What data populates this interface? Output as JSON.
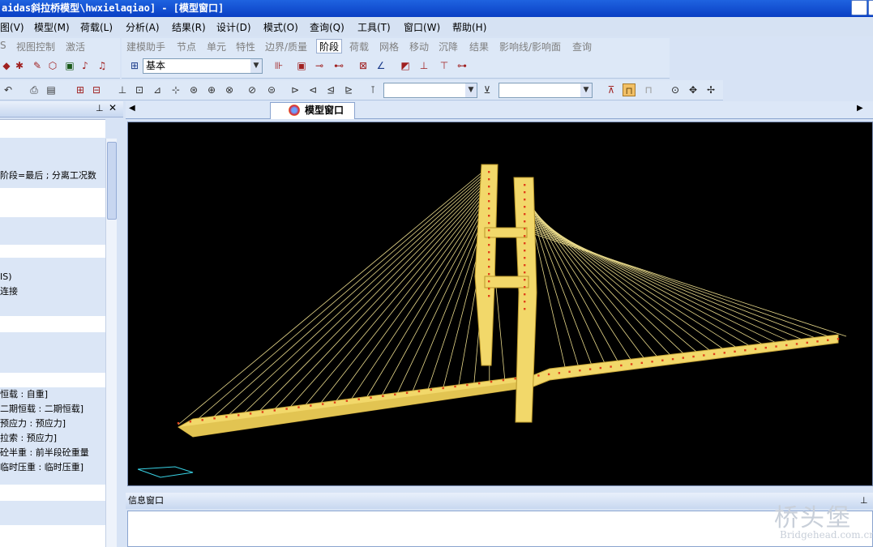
{
  "window": {
    "title": "aidas斜拉桥模型\\hwxielaqiao] - [模型窗口]"
  },
  "menu": [
    "图(V)",
    "模型(M)",
    "荷载(L)",
    "分析(A)",
    "结果(R)",
    "设计(D)",
    "模式(O)",
    "查询(Q)",
    "工具(T)",
    "窗口(W)",
    "帮助(H)"
  ],
  "toolbar1": {
    "left_tabs": [
      "S",
      "视图控制",
      "激活"
    ],
    "tabs": [
      "建模助手",
      "节点",
      "单元",
      "特性",
      "边界/质量",
      "阶段",
      "荷载",
      "网格",
      "移动",
      "沉降",
      "结果",
      "影响线/影响面",
      "查询"
    ],
    "active_tab": "阶段",
    "stage_select": "基本"
  },
  "panel": {
    "tree_rows": [
      "阶段=最后 ; 分离工况数",
      "IS)",
      "连接",
      "恒载 : 自重]",
      "二期恒载 : 二期恒载]",
      "预应力 : 预应力]",
      "拉索 : 预应力]",
      "砼半重 : 前半段砼重量",
      "临时压重 : 临时压重]"
    ]
  },
  "model_tab": {
    "label": "模型窗口"
  },
  "info": {
    "title": "信息窗口"
  },
  "watermark": {
    "main": "桥头堡",
    "url": "Bridgehead.com.cn"
  },
  "colors": {
    "background": "#000000",
    "deck": "#f2d86a",
    "cable": "#e8d98a",
    "node": "#e0401a"
  }
}
